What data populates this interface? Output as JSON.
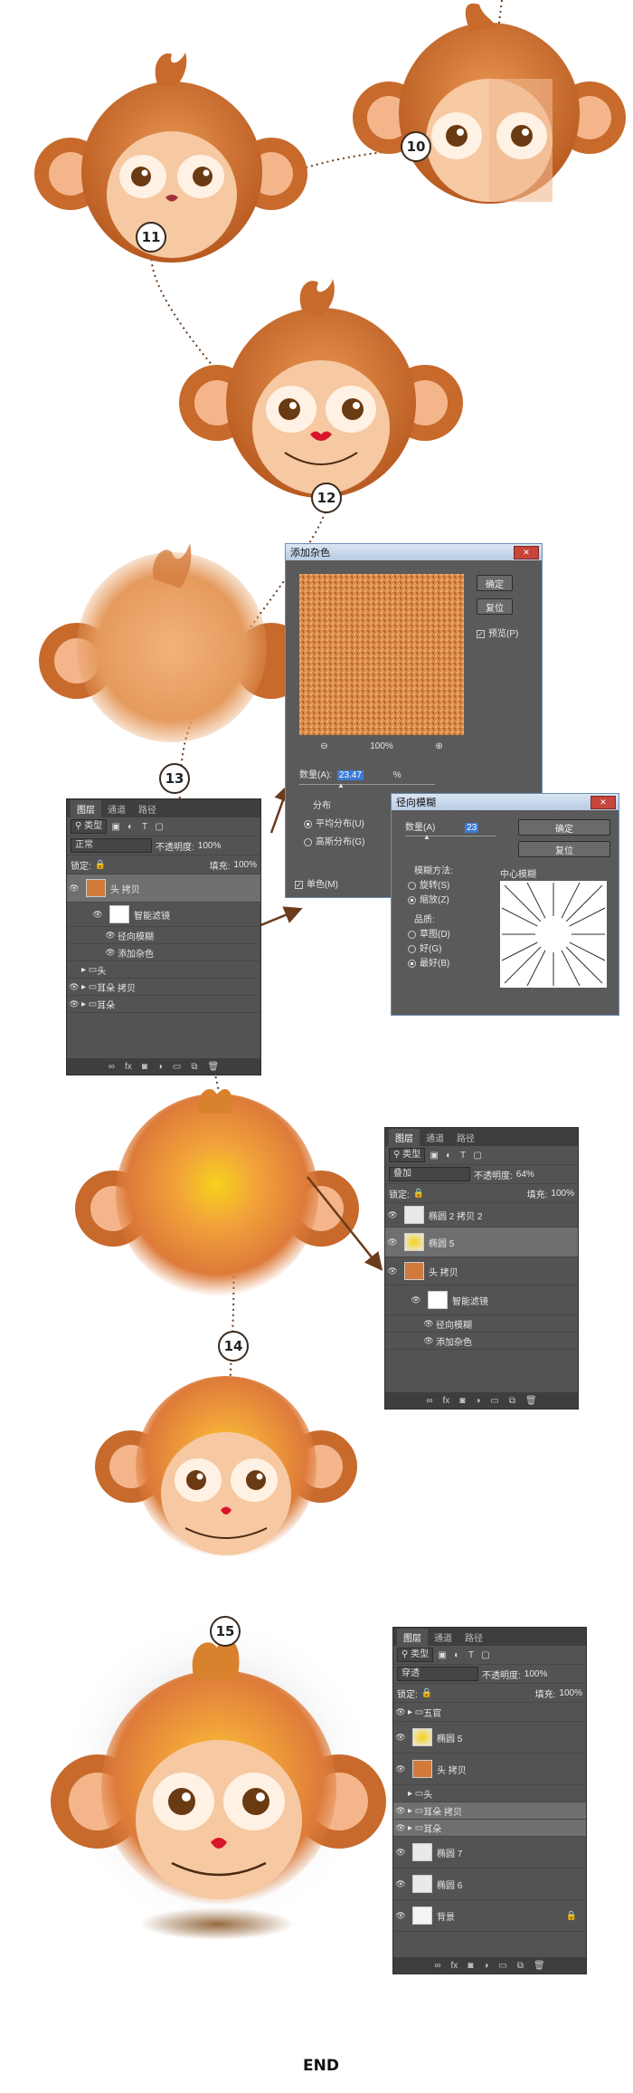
{
  "steps": {
    "s10": "10",
    "s11": "11",
    "s12": "12",
    "s13": "13",
    "s14": "14",
    "s15": "15",
    "end": "END"
  },
  "add_noise_dialog": {
    "title": "添加杂色",
    "ok": "确定",
    "reset": "复位",
    "preview": "预览(P)",
    "zoom": "100%",
    "amount_label": "数量(A):",
    "amount_value": "23.47",
    "amount_unit": "%",
    "distribution_label": "分布",
    "uniform": "平均分布(U)",
    "gaussian": "高斯分布(G)",
    "mono": "单色(M)"
  },
  "radial_blur_dialog": {
    "title": "径向模糊",
    "amount_label": "数量(A)",
    "amount_value": "23",
    "ok": "确定",
    "reset": "复位",
    "method_label": "模糊方法:",
    "spin": "旋转(S)",
    "zoom": "缩放(Z)",
    "quality_label": "品质:",
    "draft": "草图(D)",
    "good": "好(G)",
    "best": "最好(B)",
    "center_label": "中心模糊"
  },
  "layers_panel_1": {
    "tabs": [
      "图层",
      "通道",
      "路径"
    ],
    "filter": "类型",
    "blend": "正常",
    "opacity_label": "不透明度:",
    "opacity": "100%",
    "lock_label": "锁定:",
    "fill_label": "填充:",
    "fill": "100%",
    "layers": [
      "头 拷贝",
      "智能滤镜",
      "径向模糊",
      "添加杂色",
      "头",
      "耳朵 拷贝",
      "耳朵"
    ]
  },
  "layers_panel_2": {
    "tabs": [
      "图层",
      "通道",
      "路径"
    ],
    "filter": "类型",
    "blend": "叠加",
    "opacity_label": "不透明度:",
    "opacity": "64%",
    "lock_label": "锁定:",
    "fill_label": "填充:",
    "fill": "100%",
    "layers": [
      "椭圆 2 拷贝 2",
      "椭圆 5",
      "头 拷贝",
      "智能滤镜",
      "径向模糊",
      "添加杂色"
    ]
  },
  "layers_panel_3": {
    "tabs": [
      "图层",
      "通道",
      "路径"
    ],
    "filter": "类型",
    "blend": "穿透",
    "opacity_label": "不透明度:",
    "opacity": "100%",
    "lock_label": "锁定:",
    "fill_label": "填充:",
    "fill": "100%",
    "layers": [
      "五官",
      "椭圆 5",
      "头 拷贝",
      "头",
      "耳朵 拷贝",
      "耳朵",
      "椭圆 7",
      "椭圆 6",
      "背景"
    ]
  },
  "colors": {
    "fur": "#c9682a",
    "fur_light": "#e89a4e",
    "face": "#f6c9a3",
    "ear_inner": "#f4b58a",
    "nose": "#d8152a",
    "panel": "#535353",
    "dotted": "#6b3b1c"
  }
}
